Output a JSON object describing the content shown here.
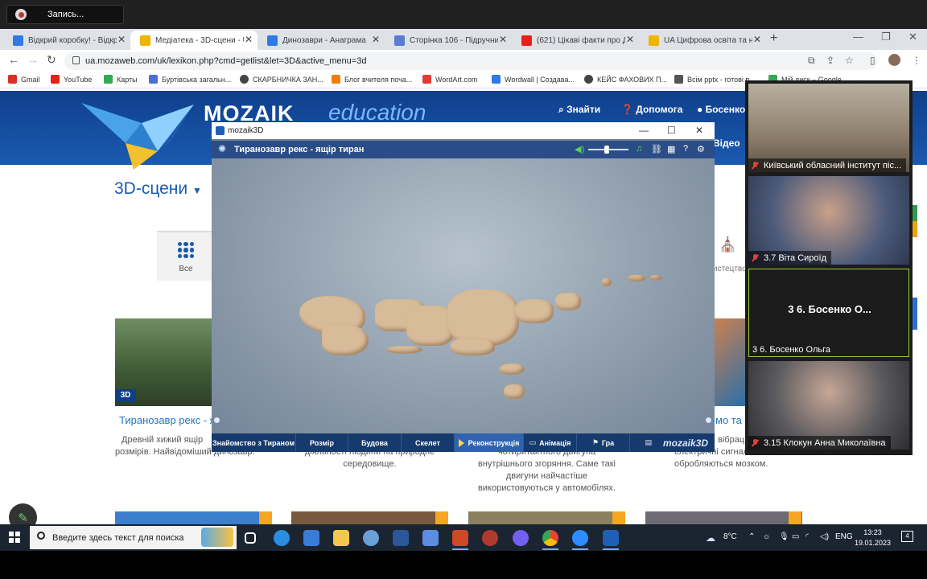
{
  "recording": {
    "label": "Запись..."
  },
  "tabs": [
    {
      "label": "Відкрий коробку! - Відкри",
      "color": "#2f7ae5"
    },
    {
      "label": "Медіатека - 3D-сцени - Ua",
      "color": "#f0b400"
    },
    {
      "label": "Динозаври - Анаграма",
      "color": "#2f7ae5"
    },
    {
      "label": "Сторінка 106 - Підручник",
      "color": "#5b7bd5"
    },
    {
      "label": "(621) Цікаві факти про ДИ",
      "color": "#e62117"
    },
    {
      "label": "UA Цифрова освіта та нав",
      "color": "#f0b400"
    }
  ],
  "address": {
    "url": "ua.mozaweb.com/uk/lexikon.php?cmd=getlist&let=3D&active_menu=3d"
  },
  "bookmarks": [
    {
      "label": "Gmail",
      "color": "#d93025"
    },
    {
      "label": "YouTube",
      "color": "#e62117"
    },
    {
      "label": "Карты",
      "color": "#34a853"
    },
    {
      "label": "Буртівська загальн...",
      "color": "#4a6fd8"
    },
    {
      "label": "СКАРБНИЧКА ЗАН...",
      "color": "#444"
    },
    {
      "label": "Блог вчителя поча...",
      "color": "#f57d00"
    },
    {
      "label": "WordArt.com",
      "color": "#e53935"
    },
    {
      "label": "Wordwall | Создава...",
      "color": "#2f7ae5"
    },
    {
      "label": "КЕЙС ФАХОВИХ П...",
      "color": "#444"
    },
    {
      "label": "Всім pptx - готові п...",
      "color": "#555"
    },
    {
      "label": "Мій диск – Google...",
      "color": "#34a853"
    }
  ],
  "site": {
    "logo": "MOZAIK",
    "logo_sub": "education",
    "search": "Знайти",
    "help": "Допомога",
    "user": "Босенко",
    "section_title": "3D-сцени",
    "filter_all": "Все",
    "filter_art": "истецтво",
    "video_tab": "Відео"
  },
  "cards": [
    {
      "badge": "3D",
      "title": "Тиранозавр рекс - ящір тиран",
      "desc1": "Древній хижий ящір",
      "desc2": "розмірів. Найвідоміший динозавр."
    },
    {
      "title": "",
      "desc1": "діяльності людини на природне",
      "desc2": "середовище."
    },
    {
      "title": "",
      "desc1": "чотиритактного двигуна",
      "desc2": "внутрішнього згоряння. Саме такі",
      "desc3": "двигуни найчастіше",
      "desc4": "використовуються у автомобілях."
    },
    {
      "title": "мо та слух",
      "desc1": "вібрац",
      "desc2": "електричні сигнали, піс",
      "desc3": "обробляються мозком."
    }
  ],
  "modal": {
    "window_title": "mozaik3D",
    "scene_title": "Тиранозавр рекс - ящір тиран",
    "volume": 0.45,
    "nav": [
      {
        "label": "Знайомство з Тираном",
        "active": false
      },
      {
        "label": "Розмір",
        "active": false
      },
      {
        "label": "Будова",
        "active": false
      },
      {
        "label": "Скелет",
        "active": false
      },
      {
        "label": "Реконструкція",
        "active": true
      },
      {
        "label": "Анімація",
        "active": false
      },
      {
        "label": "Гра",
        "active": false
      }
    ],
    "brand": "mozaik3D"
  },
  "participants": [
    {
      "name": "Київський обласний інститут піс...",
      "muted": true
    },
    {
      "name": "3.7 Віта Сироїд",
      "muted": true
    },
    {
      "name": "3  6. Босенко Ольга",
      "big": "3  6. Босенко О...",
      "muted": false
    },
    {
      "name": "3.15 Клокун Анна Миколаївна",
      "muted": true
    }
  ],
  "taskbar": {
    "search_placeholder": "Введите здесь текст для поиска",
    "temperature": "8°C",
    "lang": "ENG",
    "time": "13:23",
    "date": "19.01.2023",
    "notifications": "4"
  }
}
